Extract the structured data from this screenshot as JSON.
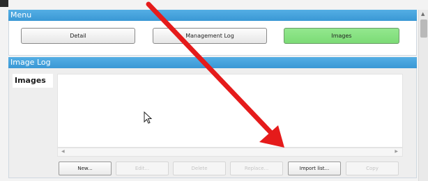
{
  "menu": {
    "title": "Menu",
    "buttons": {
      "detail": "Detail",
      "management_log": "Management Log",
      "images": "Images"
    },
    "active_color": "#8fe48a"
  },
  "image_log": {
    "title": "Image Log",
    "list_label": "Images",
    "actions": {
      "new": "New...",
      "edit": "Edit...",
      "delete": "Delete",
      "replace": "Replace...",
      "import_list": "Import list...",
      "copy": "Copy"
    }
  },
  "annotation": {
    "arrow_color": "#e51b1b",
    "icons": [
      "mouse-pointer-icon",
      "scroll-left-icon",
      "scroll-right-icon",
      "scroll-up-icon"
    ]
  }
}
